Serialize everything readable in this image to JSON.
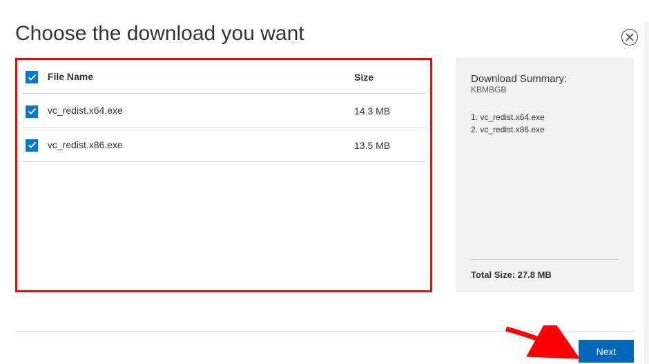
{
  "title": "Choose the download you want",
  "columns": {
    "name": "File Name",
    "size": "Size"
  },
  "files": [
    {
      "name": "vc_redist.x64.exe",
      "size": "14.3 MB",
      "checked": true
    },
    {
      "name": "vc_redist.x86.exe",
      "size": "13.5 MB",
      "checked": true
    }
  ],
  "summary": {
    "title": "Download Summary:",
    "subtitle": "KBMBGB",
    "items": [
      "vc_redist.x64.exe",
      "vc_redist.x86.exe"
    ],
    "total_label": "Total Size: 27.8 MB"
  },
  "buttons": {
    "next": "Next"
  },
  "colors": {
    "accent": "#0078d4",
    "next": "#0067b8",
    "highlight_border": "#ff0000",
    "arrow": "#ff0000"
  }
}
